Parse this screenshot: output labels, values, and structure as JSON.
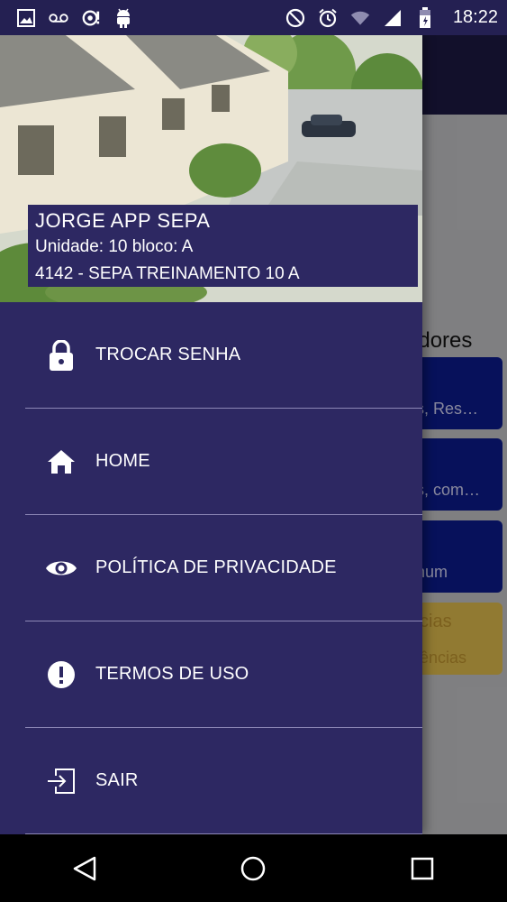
{
  "status_bar": {
    "time": "18:22",
    "left_icons": [
      "image-icon",
      "voicemail-icon",
      "sync-icon",
      "android-icon"
    ],
    "right_icons": [
      "block-icon",
      "alarm-icon",
      "wifi-icon",
      "signal-icon",
      "battery-icon"
    ]
  },
  "background": {
    "partial_title": "radores",
    "cards": [
      {
        "text": "s, Res…",
        "color": "#0b1a86"
      },
      {
        "text": "s, com…",
        "color": "#0b1a86"
      },
      {
        "text": "num",
        "color": "#0b1a86"
      },
      {
        "text_top": "cias",
        "text_bottom": "ências",
        "color": "#d6b44a"
      }
    ]
  },
  "drawer": {
    "user": {
      "name": "JORGE APP SEPA",
      "unit": "Unidade: 10 bloco: A",
      "condo": "4142 - SEPA TREINAMENTO 10 A"
    },
    "menu": [
      {
        "label": "TROCAR SENHA",
        "icon": "lock-icon"
      },
      {
        "label": "HOME",
        "icon": "home-icon"
      },
      {
        "label": "POLÍTICA DE PRIVACIDADE",
        "icon": "eye-icon"
      },
      {
        "label": "TERMOS DE USO",
        "icon": "alert-icon"
      },
      {
        "label": "SAIR",
        "icon": "logout-icon"
      }
    ]
  },
  "nav_bar": {
    "buttons": [
      "back-icon",
      "home-circle-icon",
      "recents-icon"
    ]
  },
  "colors": {
    "drawer": "#2d2862",
    "status_bar": "#242052",
    "appbar": "#1b1840"
  }
}
